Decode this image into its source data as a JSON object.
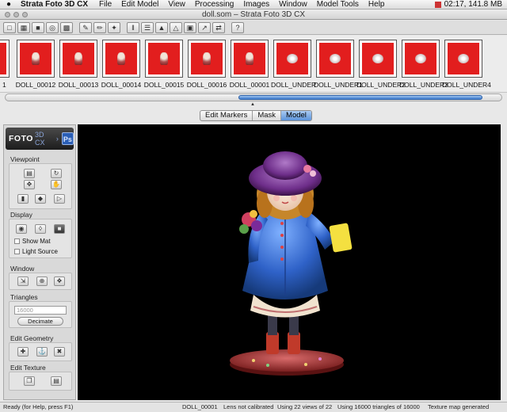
{
  "menubar": {
    "app_name": "Strata Foto 3D CX",
    "items": [
      "File",
      "Edit Model",
      "View",
      "Processing",
      "Images",
      "Window",
      "Model Tools",
      "Help"
    ],
    "status": "02:17, 141.8 MB"
  },
  "window": {
    "title": "doll.som – Strata Foto 3D CX"
  },
  "toolbar": {
    "help_label": "?"
  },
  "strip": {
    "left_index": "1",
    "thumbnails": [
      {
        "label": "DOLL_00012",
        "kind": "doll"
      },
      {
        "label": "DOLL_00013",
        "kind": "doll"
      },
      {
        "label": "DOLL_00014",
        "kind": "doll"
      },
      {
        "label": "DOLL_00015",
        "kind": "doll"
      },
      {
        "label": "DOLL_00016",
        "kind": "doll"
      },
      {
        "label": "DOLL_00001",
        "kind": "doll"
      },
      {
        "label": "DOLL_UNDER",
        "kind": "under"
      },
      {
        "label": "DOLL_UNDER1",
        "kind": "under"
      },
      {
        "label": "DOLL_UNDER2",
        "kind": "under"
      },
      {
        "label": "DOLL_UNDER3",
        "kind": "under"
      },
      {
        "label": "DOLL_UNDER4",
        "kind": "under"
      }
    ]
  },
  "tabs": {
    "items": [
      "Edit Markers",
      "Mask",
      "Model"
    ],
    "active": "Model"
  },
  "panel": {
    "logo_text": "FOTO",
    "logo_sub": "3D CX",
    "logo_ps": "Ps",
    "viewpoint_title": "Viewpoint",
    "display_title": "Display",
    "show_mat": "Show Mat",
    "light_source": "Light Source",
    "window_title": "Window",
    "triangles_title": "Triangles",
    "triangles_value": "16000",
    "decimate_label": "Decimate",
    "edit_geometry_title": "Edit Geometry",
    "edit_texture_title": "Edit Texture"
  },
  "status": {
    "help": "Ready (for Help, press F1)",
    "image": "DOLL_00001",
    "lens": "Lens not calibrated",
    "views": "Using 22 views of 22",
    "triangles": "Using 16000 triangles of 16000",
    "texture": "Texture map generated"
  }
}
